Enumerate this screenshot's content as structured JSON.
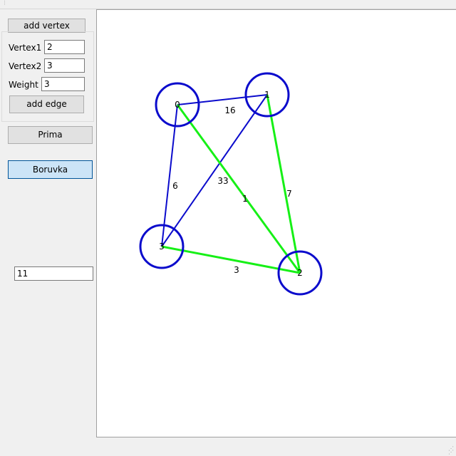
{
  "controls": {
    "add_vertex_label": "add vertex",
    "vertex1_label": "Vertex1",
    "vertex1_value": "2",
    "vertex2_label": "Vertex2",
    "vertex2_value": "3",
    "weight_label": "Weight",
    "weight_value": "3",
    "add_edge_label": "add edge",
    "prima_label": "Prima",
    "boruvka_label": "Boruvka",
    "result_value": "11"
  },
  "graph": {
    "colors": {
      "vertex": "#0b0bcc",
      "edge": "#0b0bcc",
      "mst_edge": "#16f016",
      "label": "#000000"
    },
    "vertices": [
      {
        "id": "0",
        "label": "0"
      },
      {
        "id": "1",
        "label": "1"
      },
      {
        "id": "2",
        "label": "2"
      },
      {
        "id": "3",
        "label": "3"
      }
    ],
    "edges": [
      {
        "from": "0",
        "to": "1",
        "weight": "16",
        "in_mst": false
      },
      {
        "from": "0",
        "to": "3",
        "weight": "6",
        "in_mst": false
      },
      {
        "from": "1",
        "to": "3",
        "weight": "33",
        "in_mst": false
      },
      {
        "from": "0",
        "to": "2",
        "weight": "1",
        "in_mst": true
      },
      {
        "from": "1",
        "to": "2",
        "weight": "7",
        "in_mst": true
      },
      {
        "from": "3",
        "to": "2",
        "weight": "3",
        "in_mst": true
      }
    ]
  }
}
